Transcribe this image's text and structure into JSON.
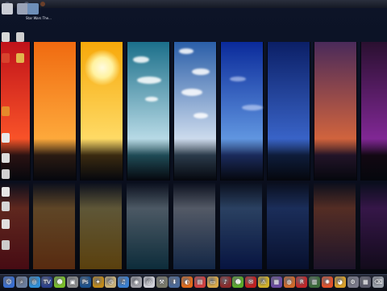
{
  "desktop": {
    "top_icons": [
      {
        "name": "recycle-bin-icon",
        "label": "",
        "color": "#c9ccd4"
      },
      {
        "name": "folder-icon",
        "label": "",
        "color": "#9aa3b7"
      },
      {
        "name": "network-icon",
        "label": "Star Wars The...",
        "color": "#6e8fb8"
      }
    ],
    "side_icons": [
      {
        "name": "doc-icon-1",
        "label": "",
        "color": "#d8d8d8"
      },
      {
        "name": "doc-icon-2",
        "label": "",
        "color": "#cfcfcf"
      },
      {
        "name": "app-icon-red",
        "label": "",
        "color": "#d7432d"
      },
      {
        "name": "folder-icon-2",
        "label": "",
        "color": "#e2b54c"
      },
      {
        "name": "orange-app-icon",
        "label": "",
        "color": "#e58a2b"
      },
      {
        "name": "doc-icon-3",
        "label": "",
        "color": "#e8e8e8"
      },
      {
        "name": "doc-icon-4",
        "label": "",
        "color": "#dcdcdc"
      },
      {
        "name": "doc-icon-5",
        "label": "",
        "color": "#d0d0d0"
      },
      {
        "name": "doc-icon-6",
        "label": "",
        "color": "#e6e6e6"
      },
      {
        "name": "doc-icon-7",
        "label": "",
        "color": "#d6d6d6"
      },
      {
        "name": "doc-icon-8",
        "label": "",
        "color": "#e0e0e0"
      },
      {
        "name": "doc-icon-9",
        "label": "",
        "color": "#cccccc"
      }
    ]
  },
  "wallpaper": {
    "strips": [
      {
        "name": "strip-red-sunset",
        "sky_top": "#c0121a",
        "sky_bottom": "#ff5a2a",
        "ground": "#2a1212"
      },
      {
        "name": "strip-orange-sunset",
        "sky_top": "#f06a10",
        "sky_bottom": "#ffb040",
        "ground": "#2a1a12"
      },
      {
        "name": "strip-yellow-sun",
        "sky_top": "#f7a80a",
        "sky_bottom": "#ffe070",
        "ground": "#3a2a10"
      },
      {
        "name": "strip-teal-sky",
        "sky_top": "#1b6f8a",
        "sky_bottom": "#c9e6f0",
        "ground": "#1f4a55"
      },
      {
        "name": "strip-blue-clouds",
        "sky_top": "#2a5ea8",
        "sky_bottom": "#dfe9f5",
        "ground": "#2a3a4a"
      },
      {
        "name": "strip-deep-blue",
        "sky_top": "#0a2a9a",
        "sky_bottom": "#6aa2e8",
        "ground": "#1a2a5a"
      },
      {
        "name": "strip-navy",
        "sky_top": "#0b1f66",
        "sky_bottom": "#3e6bd2",
        "ground": "#0e1c3a"
      },
      {
        "name": "strip-purple-dusk",
        "sky_top": "#4a2a5a",
        "sky_bottom": "#e06a3a",
        "ground": "#221428"
      },
      {
        "name": "strip-violet-night",
        "sky_top": "#2a1030",
        "sky_bottom": "#8a2aa0",
        "ground": "#120812"
      }
    ]
  },
  "dock": {
    "items": [
      {
        "name": "finder-icon",
        "glyph": "☺",
        "color": "#3a6fd0"
      },
      {
        "name": "search-icon",
        "glyph": "⌕",
        "color": "#6b7fa0"
      },
      {
        "name": "magnifier-icon",
        "glyph": "◎",
        "color": "#2f8fd8"
      },
      {
        "name": "tv-icon",
        "glyph": "TV",
        "color": "#2a3f8a"
      },
      {
        "name": "smiley-icon",
        "glyph": "☻",
        "color": "#7bbf2a"
      },
      {
        "name": "window-icon",
        "glyph": "▣",
        "color": "#8a8a8a"
      },
      {
        "name": "photoshop-icon",
        "glyph": "Ps",
        "color": "#1a4f8a"
      },
      {
        "name": "game-icon",
        "glyph": "✦",
        "color": "#c08a1a"
      },
      {
        "name": "clock-icon",
        "glyph": "◷",
        "color": "#c9b27a"
      },
      {
        "name": "itunes-icon",
        "glyph": "♫",
        "color": "#3a7fd0"
      },
      {
        "name": "disc-icon",
        "glyph": "◉",
        "color": "#a0a0a8"
      },
      {
        "name": "cd-icon",
        "glyph": "◎",
        "color": "#d0d0d8"
      },
      {
        "name": "tools-icon",
        "glyph": "⚒",
        "color": "#7a7a6a"
      },
      {
        "name": "download-icon",
        "glyph": "⬇",
        "color": "#4a6a9a"
      },
      {
        "name": "firefox-icon",
        "glyph": "◐",
        "color": "#e06a1a"
      },
      {
        "name": "calendar-icon",
        "glyph": "▤",
        "color": "#d04040"
      },
      {
        "name": "folder-dock-icon",
        "glyph": "▭",
        "color": "#d8a84a"
      },
      {
        "name": "audio-icon",
        "glyph": "♪",
        "color": "#8a2a2a"
      },
      {
        "name": "msn-icon",
        "glyph": "☻",
        "color": "#5aaa2a"
      },
      {
        "name": "mail-icon",
        "glyph": "✉",
        "color": "#c02020"
      },
      {
        "name": "warning-icon",
        "glyph": "⚠",
        "color": "#d0b02a"
      },
      {
        "name": "stack-icon",
        "glyph": "▦",
        "color": "#6a4aa0"
      },
      {
        "name": "ring-icon",
        "glyph": "◍",
        "color": "#d06a2a"
      },
      {
        "name": "app-r-icon",
        "glyph": "R",
        "color": "#c0282a"
      },
      {
        "name": "chart-icon",
        "glyph": "▥",
        "color": "#3a6a3a"
      },
      {
        "name": "pinwheel-icon",
        "glyph": "✺",
        "color": "#e0502a"
      },
      {
        "name": "chrome-icon",
        "glyph": "◕",
        "color": "#d8a02a"
      },
      {
        "name": "gear-icon",
        "glyph": "⚙",
        "color": "#7a7a8a"
      },
      {
        "name": "grid-icon",
        "glyph": "▦",
        "color": "#5a5a6a"
      },
      {
        "name": "trash-icon",
        "glyph": "⌫",
        "color": "#9aa0aa"
      }
    ]
  }
}
